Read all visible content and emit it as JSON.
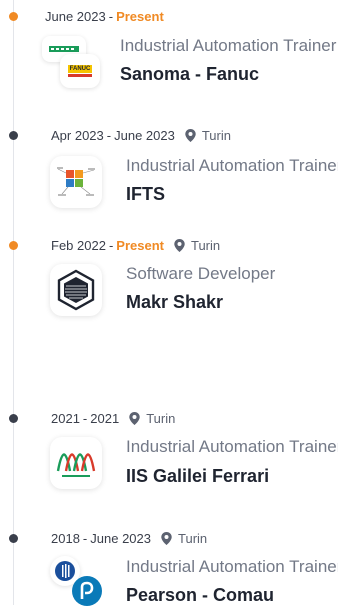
{
  "entries": [
    {
      "start": "June 2023",
      "separator": "-",
      "end": "Present",
      "location": "",
      "role": "Industrial Automation Trainer",
      "company": "Sanoma - Fanuc",
      "logo": "sanoma-fanuc-logo",
      "logo_text": "FANUC"
    },
    {
      "start": "Apr 2023",
      "separator": "-",
      "end": "June 2023",
      "location": "Turin",
      "role": "Industrial Automation Trainer",
      "company": "IFTS",
      "logo": "ifts-logo"
    },
    {
      "start": "Feb 2022",
      "separator": "-",
      "end": "Present",
      "location": "Turin",
      "role": "Software Developer",
      "company": "Makr Shakr",
      "logo": "makr-shakr-logo"
    },
    {
      "start": "2021",
      "separator": "-",
      "end": "2021",
      "location": "Turin",
      "role": "Industrial Automation Trainer",
      "company": "IIS Galilei Ferrari",
      "logo": "iis-galilei-ferrari-logo"
    },
    {
      "start": "2018",
      "separator": "-",
      "end": "June 2023",
      "location": "Turin",
      "role": "Industrial Automation Trainer",
      "company": "Pearson - Comau",
      "logo": "pearson-comau-logo"
    }
  ],
  "colors": {
    "accent": "#f08a24",
    "dot": "#3a3f4b",
    "line": "#e3e5ea",
    "role": "#737987",
    "company": "#1f2430"
  }
}
